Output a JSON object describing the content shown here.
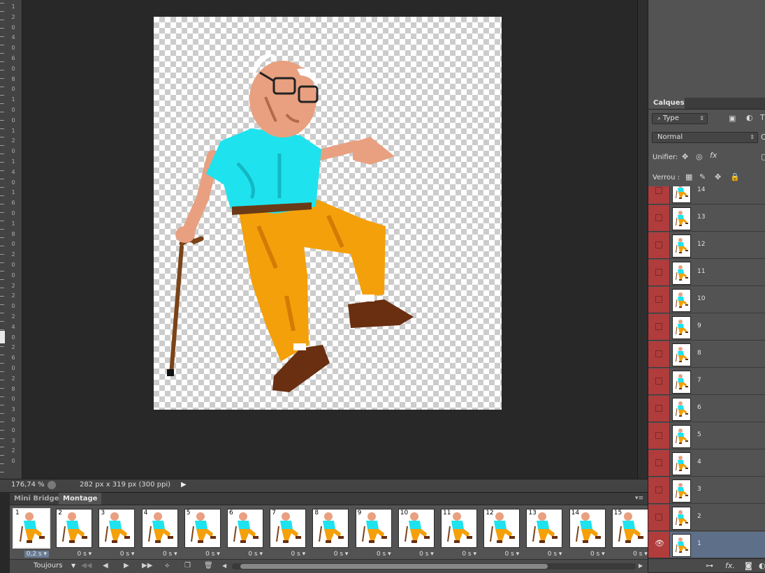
{
  "ruler": {
    "labels": [
      "1",
      "2",
      "0",
      "4",
      "0",
      "6",
      "0",
      "8",
      "0",
      "1",
      "0",
      "0",
      "1",
      "2",
      "0",
      "1",
      "4",
      "0",
      "1",
      "6",
      "0",
      "1",
      "8",
      "0",
      "2",
      "0",
      "0",
      "2",
      "2",
      "0",
      "2",
      "4",
      "0",
      "2",
      "6",
      "0",
      "2",
      "8",
      "0",
      "3",
      "0",
      "0",
      "3",
      "2",
      "0"
    ]
  },
  "status": {
    "zoom": "176,74 %",
    "doc_info": "282 px x 319 px (300 ppi)"
  },
  "layers_panel": {
    "tab": "Calques",
    "filter_type": "Type",
    "blend_mode": "Normal",
    "unify_label": "Unifier:",
    "lock_label": "Verrou :",
    "layers": [
      "14",
      "13",
      "12",
      "11",
      "10",
      "9",
      "8",
      "7",
      "6",
      "5",
      "4",
      "3",
      "2",
      "1"
    ],
    "selected": "1"
  },
  "timeline": {
    "tabs": [
      "Mini Bridge",
      "Montage"
    ],
    "active_tab": "Montage",
    "frames": [
      {
        "n": "1",
        "delay": "0,2 s"
      },
      {
        "n": "2",
        "delay": "0 s"
      },
      {
        "n": "3",
        "delay": "0 s"
      },
      {
        "n": "4",
        "delay": "0 s"
      },
      {
        "n": "5",
        "delay": "0 s"
      },
      {
        "n": "6",
        "delay": "0 s"
      },
      {
        "n": "7",
        "delay": "0 s"
      },
      {
        "n": "8",
        "delay": "0 s"
      },
      {
        "n": "9",
        "delay": "0 s"
      },
      {
        "n": "10",
        "delay": "0 s"
      },
      {
        "n": "11",
        "delay": "0 s"
      },
      {
        "n": "12",
        "delay": "0 s"
      },
      {
        "n": "13",
        "delay": "0 s"
      },
      {
        "n": "14",
        "delay": "0 s"
      },
      {
        "n": "15",
        "delay": "0 s"
      }
    ],
    "loop": "Toujours"
  },
  "colors": {
    "hidden_layer": "#b03c3c",
    "selected_layer": "#5e6f89",
    "shirt": "#1ee3ee",
    "pants": "#f4a00a",
    "skin": "#e8a080",
    "shoe": "#6a2e10"
  }
}
